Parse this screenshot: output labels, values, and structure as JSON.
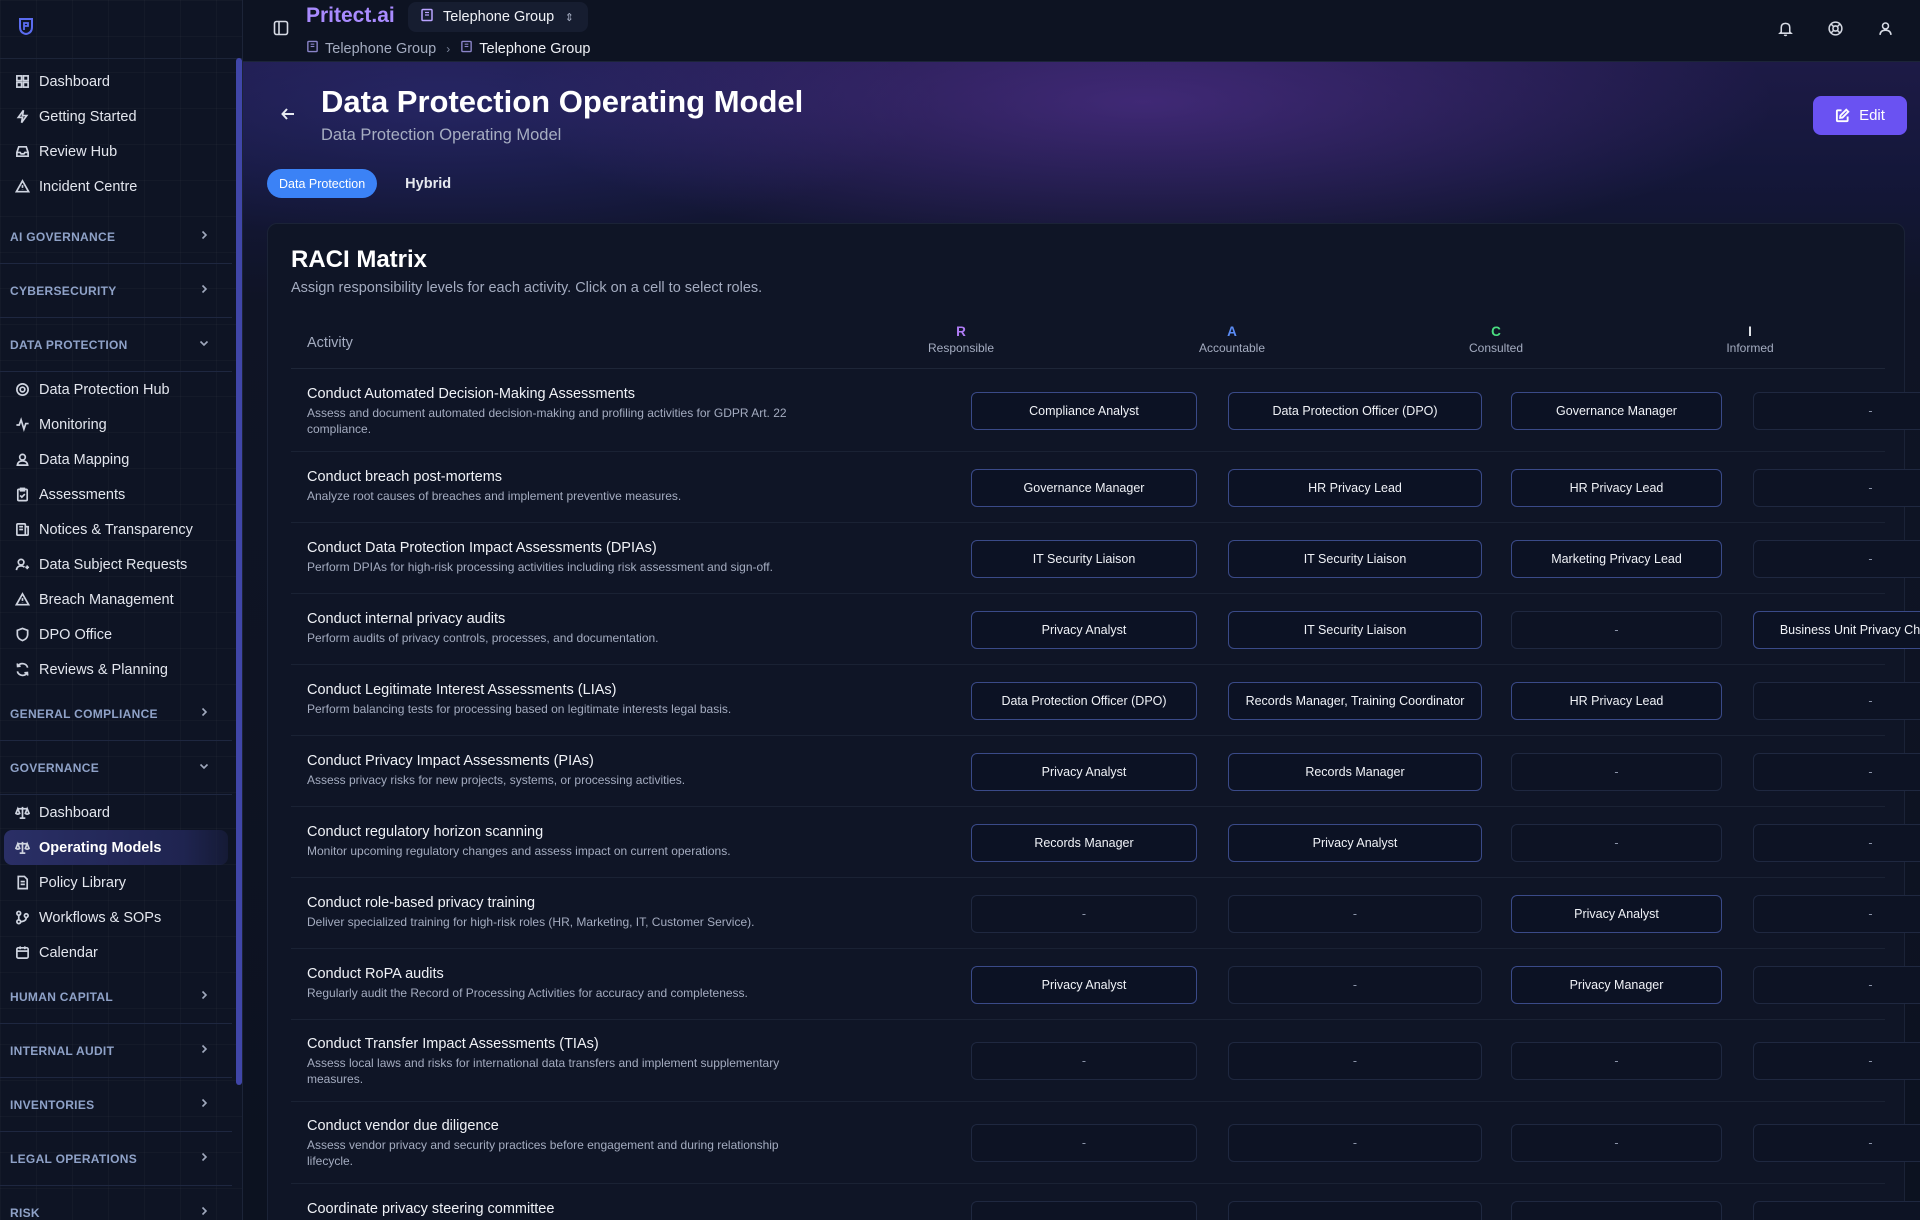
{
  "app": {
    "brand": "Pritect.ai",
    "org_name": "Telephone Group"
  },
  "colors": {
    "brand": "#a98bff",
    "accent": "#6a52f2",
    "tab_active": "#3b82f6",
    "r": "#b07cf5",
    "a": "#5b8cf5",
    "c": "#4ade80",
    "i": "#e5e7eb"
  },
  "breadcrumb": [
    "Telephone Group",
    "Telephone Group"
  ],
  "sidebar": {
    "top_items": [
      {
        "label": "Dashboard",
        "icon": "grid-icon"
      },
      {
        "label": "Getting Started",
        "icon": "bolt-icon"
      },
      {
        "label": "Review Hub",
        "icon": "inbox-icon"
      },
      {
        "label": "Incident Centre",
        "icon": "warning-icon"
      }
    ],
    "sections": [
      {
        "label": "AI GOVERNANCE",
        "expanded": false,
        "items": []
      },
      {
        "label": "CYBERSECURITY",
        "expanded": false,
        "items": []
      },
      {
        "label": "DATA PROTECTION",
        "expanded": true,
        "items": [
          {
            "label": "Data Protection Hub",
            "icon": "hub-icon"
          },
          {
            "label": "Monitoring",
            "icon": "activity-icon"
          },
          {
            "label": "Data Mapping",
            "icon": "user-map-icon"
          },
          {
            "label": "Assessments",
            "icon": "clipboard-icon"
          },
          {
            "label": "Notices & Transparency",
            "icon": "notice-icon"
          },
          {
            "label": "Data Subject Requests",
            "icon": "user-request-icon"
          },
          {
            "label": "Breach Management",
            "icon": "warning-icon"
          },
          {
            "label": "DPO Office",
            "icon": "shield-icon"
          },
          {
            "label": "Reviews & Planning",
            "icon": "refresh-icon"
          }
        ]
      },
      {
        "label": "GENERAL COMPLIANCE",
        "expanded": false,
        "items": []
      },
      {
        "label": "GOVERNANCE",
        "expanded": true,
        "items": [
          {
            "label": "Dashboard",
            "icon": "scale-icon"
          },
          {
            "label": "Operating Models",
            "icon": "scale-icon",
            "active": true
          },
          {
            "label": "Policy Library",
            "icon": "document-icon"
          },
          {
            "label": "Workflows & SOPs",
            "icon": "workflow-icon"
          },
          {
            "label": "Calendar",
            "icon": "calendar-icon"
          }
        ]
      },
      {
        "label": "HUMAN CAPITAL",
        "expanded": false,
        "items": []
      },
      {
        "label": "INTERNAL AUDIT",
        "expanded": false,
        "items": []
      },
      {
        "label": "INVENTORIES",
        "expanded": false,
        "items": []
      },
      {
        "label": "LEGAL OPERATIONS",
        "expanded": false,
        "items": []
      },
      {
        "label": "RISK",
        "expanded": false,
        "items": []
      }
    ]
  },
  "page": {
    "title": "Data Protection Operating Model",
    "subtitle": "Data Protection Operating Model",
    "edit_label": "Edit",
    "tabs": [
      "Data Protection",
      "Hybrid"
    ]
  },
  "raci": {
    "title": "RACI Matrix",
    "description": "Assign responsibility levels for each activity. Click on a cell to select roles.",
    "activity_header": "Activity",
    "columns": [
      {
        "letter": "R",
        "word": "Responsible"
      },
      {
        "letter": "A",
        "word": "Accountable"
      },
      {
        "letter": "C",
        "word": "Consulted"
      },
      {
        "letter": "I",
        "word": "Informed"
      }
    ],
    "rows": [
      {
        "name": "Conduct Automated Decision-Making Assessments",
        "desc": "Assess and document automated decision-making and profiling activities for GDPR Art. 22 compliance.",
        "cells": [
          "Compliance Analyst",
          "Data Protection Officer (DPO)",
          "Governance Manager",
          "-"
        ]
      },
      {
        "name": "Conduct breach post-mortems",
        "desc": "Analyze root causes of breaches and implement preventive measures.",
        "cells": [
          "Governance Manager",
          "HR Privacy Lead",
          "HR Privacy Lead",
          "-"
        ]
      },
      {
        "name": "Conduct Data Protection Impact Assessments (DPIAs)",
        "desc": "Perform DPIAs for high-risk processing activities including risk assessment and sign-off.",
        "cells": [
          "IT Security Liaison",
          "IT Security Liaison",
          "Marketing Privacy Lead",
          "-"
        ]
      },
      {
        "name": "Conduct internal privacy audits",
        "desc": "Perform audits of privacy controls, processes, and documentation.",
        "cells": [
          "Privacy Analyst",
          "IT Security Liaison",
          "-",
          "Business Unit Privacy Champion"
        ]
      },
      {
        "name": "Conduct Legitimate Interest Assessments (LIAs)",
        "desc": "Perform balancing tests for processing based on legitimate interests legal basis.",
        "cells": [
          "Data Protection Officer (DPO)",
          "Records Manager, Training Coordinator",
          "HR Privacy Lead",
          "-"
        ]
      },
      {
        "name": "Conduct Privacy Impact Assessments (PIAs)",
        "desc": "Assess privacy risks for new projects, systems, or processing activities.",
        "cells": [
          "Privacy Analyst",
          "Records Manager",
          "-",
          "-"
        ]
      },
      {
        "name": "Conduct regulatory horizon scanning",
        "desc": "Monitor upcoming regulatory changes and assess impact on current operations.",
        "cells": [
          "Records Manager",
          "Privacy Analyst",
          "-",
          "-"
        ]
      },
      {
        "name": "Conduct role-based privacy training",
        "desc": "Deliver specialized training for high-risk roles (HR, Marketing, IT, Customer Service).",
        "cells": [
          "-",
          "-",
          "Privacy Analyst",
          "-"
        ]
      },
      {
        "name": "Conduct RoPA audits",
        "desc": "Regularly audit the Record of Processing Activities for accuracy and completeness.",
        "cells": [
          "Privacy Analyst",
          "-",
          "Privacy Manager",
          "-"
        ]
      },
      {
        "name": "Conduct Transfer Impact Assessments (TIAs)",
        "desc": "Assess local laws and risks for international data transfers and implement supplementary measures.",
        "cells": [
          "-",
          "-",
          "-",
          "-"
        ]
      },
      {
        "name": "Conduct vendor due diligence",
        "desc": "Assess vendor privacy and security practices before engagement and during relationship lifecycle.",
        "cells": [
          "-",
          "-",
          "-",
          "-"
        ]
      },
      {
        "name": "Coordinate privacy steering committee",
        "desc": "",
        "cells": [
          "-",
          "-",
          "-",
          "-"
        ]
      }
    ]
  }
}
